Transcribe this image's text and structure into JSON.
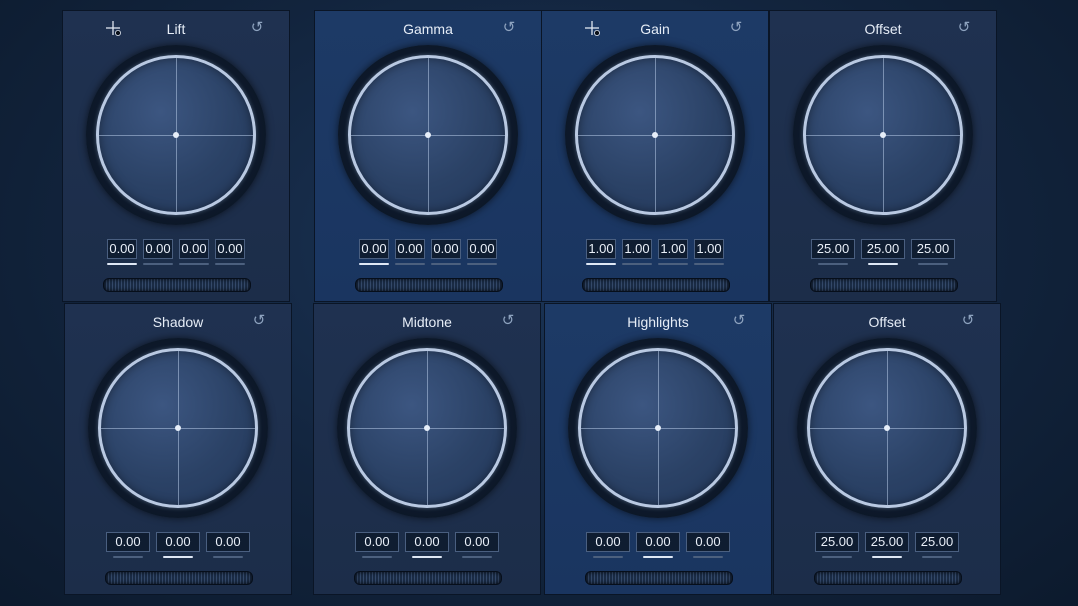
{
  "panels": [
    {
      "title": "Lift",
      "values": [
        "0.00",
        "0.00",
        "0.00",
        "0.00"
      ],
      "picker": true
    },
    {
      "title": "Gamma",
      "values": [
        "0.00",
        "0.00",
        "0.00",
        "0.00"
      ],
      "picker": false
    },
    {
      "title": "Gain",
      "values": [
        "1.00",
        "1.00",
        "1.00",
        "1.00"
      ],
      "picker": true
    },
    {
      "title": "Offset",
      "values": [
        "25.00",
        "25.00",
        "25.00"
      ],
      "picker": false
    },
    {
      "title": "Shadow",
      "values": [
        "0.00",
        "0.00",
        "0.00"
      ],
      "picker": false
    },
    {
      "title": "Midtone",
      "values": [
        "0.00",
        "0.00",
        "0.00"
      ],
      "picker": false
    },
    {
      "title": "Highlights",
      "values": [
        "0.00",
        "0.00",
        "0.00"
      ],
      "picker": false
    },
    {
      "title": "Offset",
      "values": [
        "25.00",
        "25.00",
        "25.00"
      ],
      "picker": false
    }
  ],
  "icons": {
    "reset": "reset-icon",
    "picker": "color-picker-icon"
  }
}
